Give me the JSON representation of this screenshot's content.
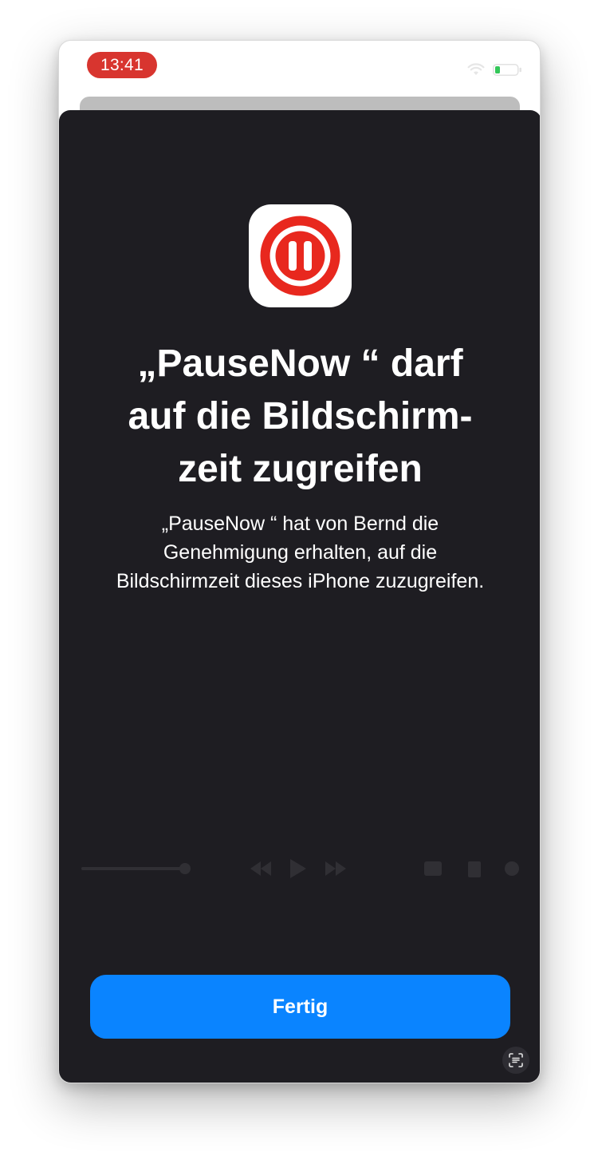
{
  "status_bar": {
    "time": "13:41",
    "time_pill_color": "#d8352f",
    "icons": [
      "wifi-icon",
      "battery-icon"
    ]
  },
  "permission_sheet": {
    "app_icon": "pause-icon",
    "title": "„PauseNow “ darf\nauf die Bildschirm-\nzeit zugreifen",
    "description": "„PauseNow “ hat von Bernd die\nGenehmigung erhalten, auf die\nBildschirmzeit dieses iPhone zuzugreifen.",
    "done_button_label": "Fertig",
    "accent_color": "#0a84ff",
    "background_color": "#1e1d22"
  },
  "corner_button": {
    "icon": "text-scan-icon"
  }
}
